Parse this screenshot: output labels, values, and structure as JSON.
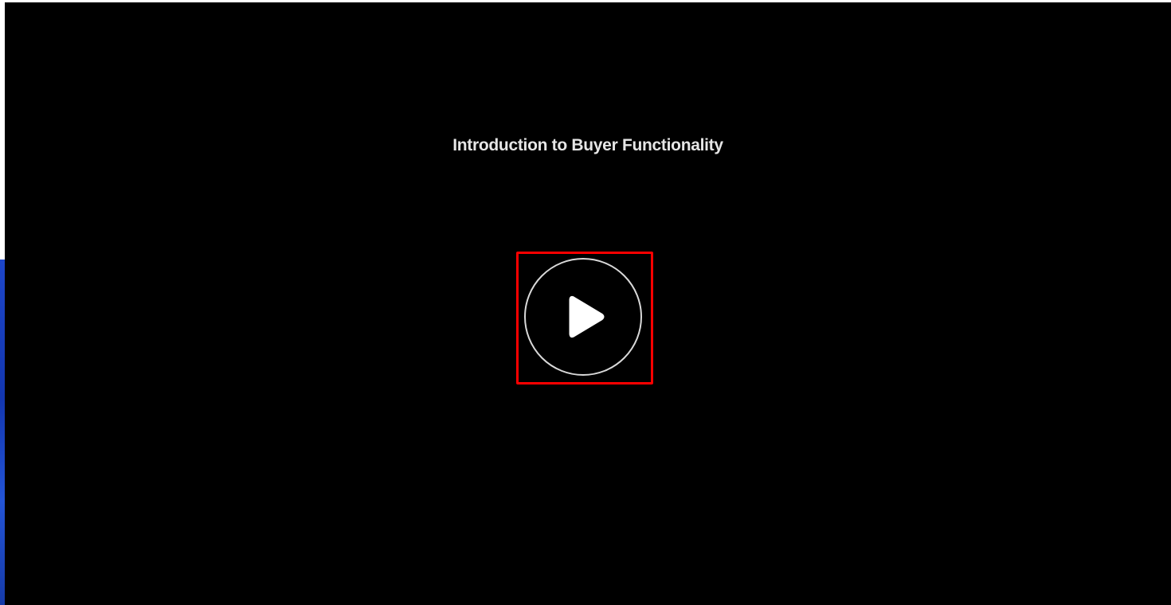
{
  "video": {
    "title": "Introduction to Buyer Functionality",
    "play_button": {
      "icon": "play-icon",
      "highlighted": true,
      "highlight_color": "#ff0000"
    }
  },
  "colors": {
    "player_background": "#000000",
    "title_text": "#e6e6e6",
    "side_accent": "#1d46c9"
  }
}
